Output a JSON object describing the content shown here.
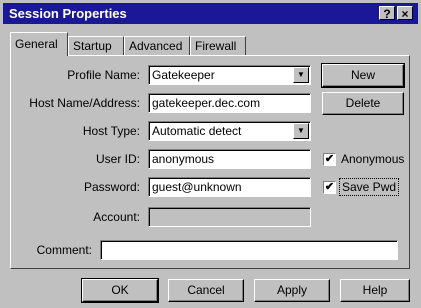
{
  "window": {
    "title": "Session Properties",
    "help_btn": "?",
    "close_btn": "×"
  },
  "tabs": [
    {
      "label": "General"
    },
    {
      "label": "Startup"
    },
    {
      "label": "Advanced"
    },
    {
      "label": "Firewall"
    }
  ],
  "form": {
    "profile_name": {
      "label": "Profile Name:",
      "value": "Gatekeeper"
    },
    "host_name": {
      "label": "Host Name/Address:",
      "value": "gatekeeper.dec.com"
    },
    "host_type": {
      "label": "Host Type:",
      "value": "Automatic detect"
    },
    "user_id": {
      "label": "User ID:",
      "value": "anonymous"
    },
    "password": {
      "label": "Password:",
      "value": "guest@unknown"
    },
    "account": {
      "label": "Account:",
      "value": ""
    },
    "comment": {
      "label": "Comment:",
      "value": ""
    }
  },
  "side_buttons": {
    "new": "New",
    "delete": "Delete"
  },
  "checkboxes": {
    "anonymous": {
      "label": "Anonymous",
      "checked": true,
      "mark": "✔"
    },
    "save_pwd": {
      "label": "Save Pwd",
      "checked": true,
      "mark": "✔"
    }
  },
  "dropdown_arrow": "▼",
  "footer_buttons": {
    "ok": "OK",
    "cancel": "Cancel",
    "apply": "Apply",
    "help": "Help"
  }
}
